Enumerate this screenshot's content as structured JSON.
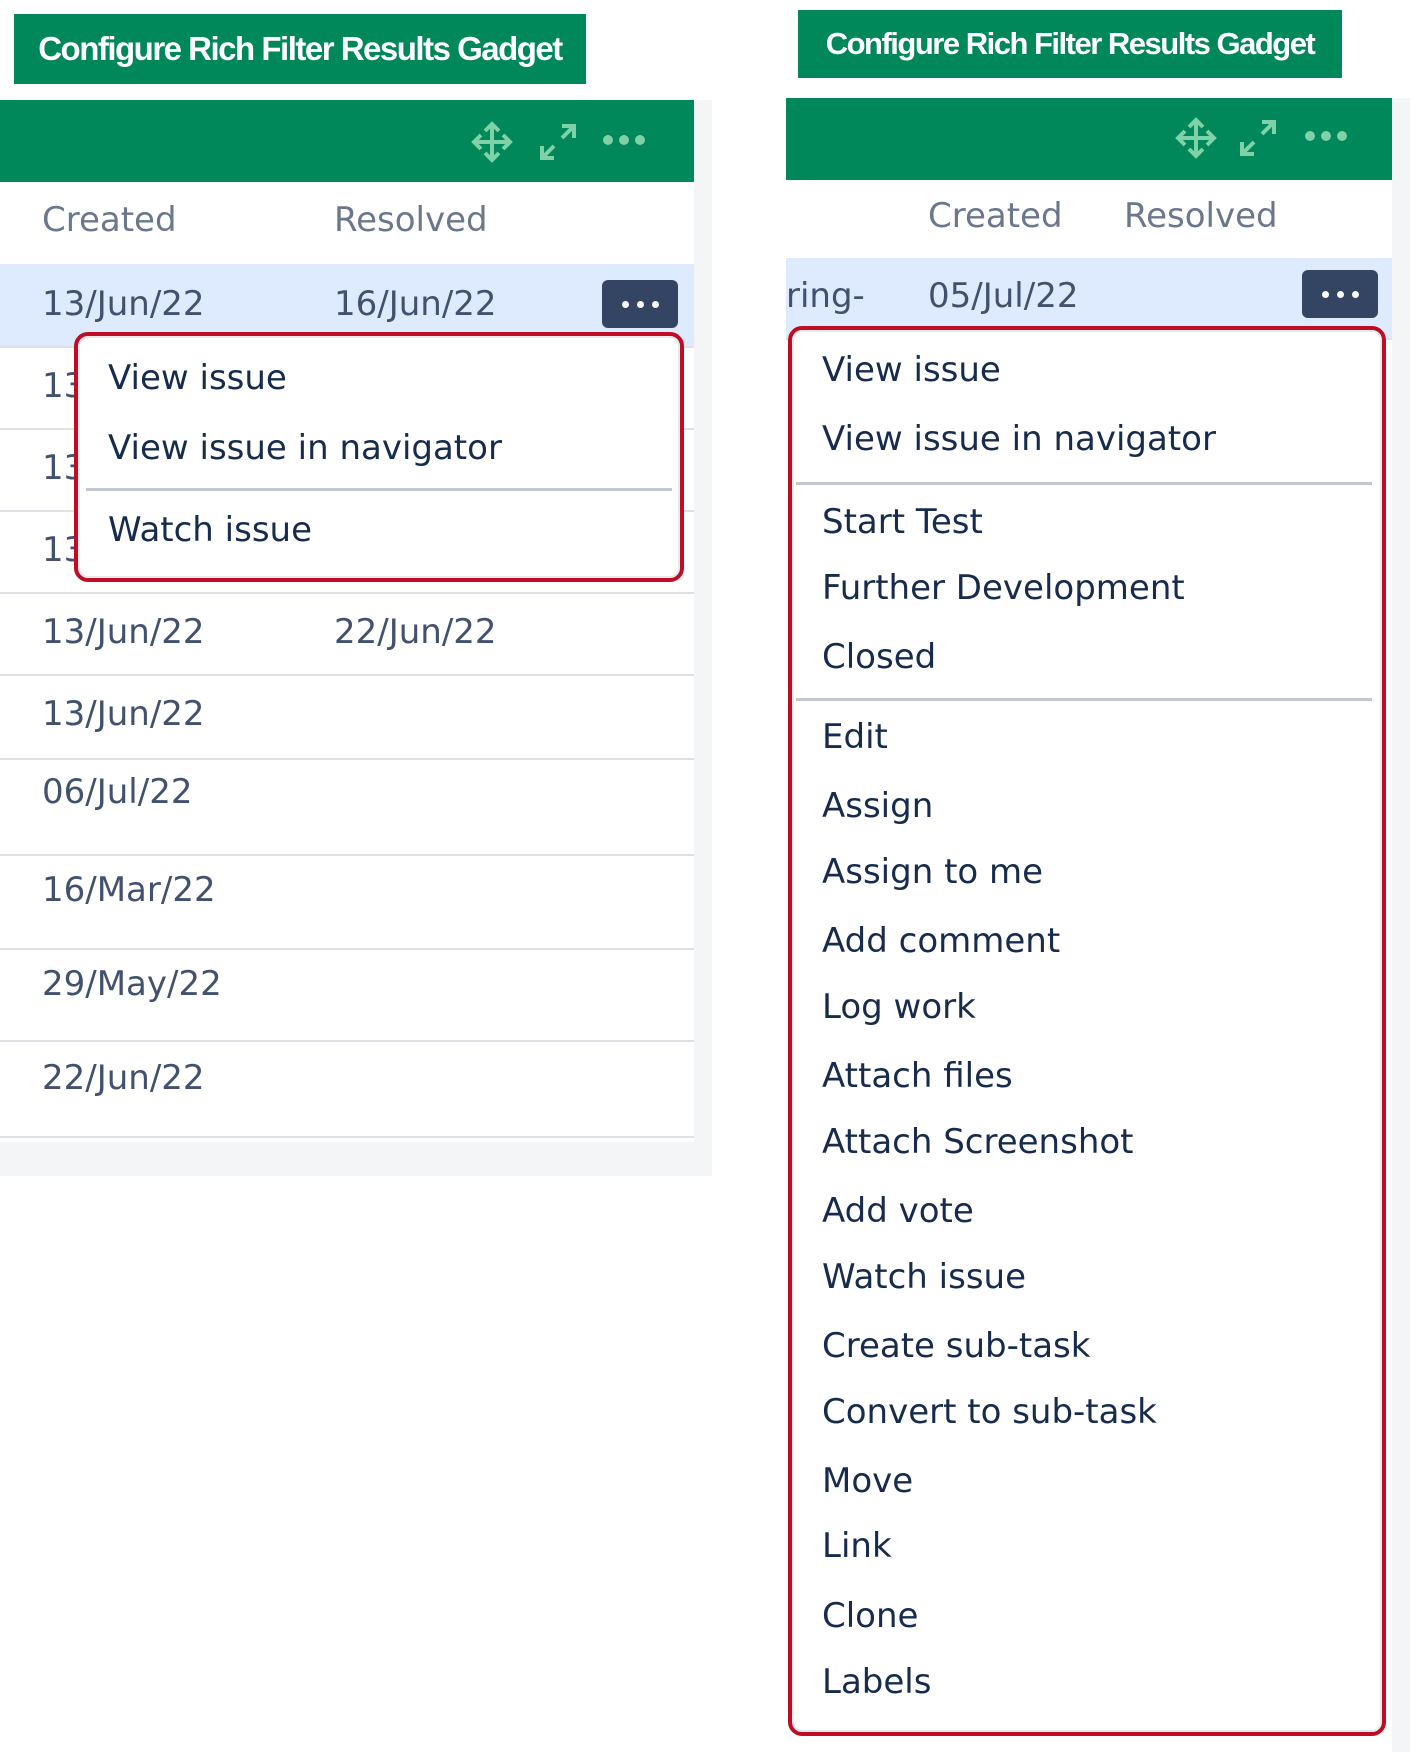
{
  "left": {
    "configure_label": "Configure Rich Filter Results Gadget",
    "columns": [
      "Created",
      "Resolved"
    ],
    "rows": [
      {
        "created": "13/Jun/22",
        "resolved": "16/Jun/22"
      },
      {
        "created": "13",
        "resolved": ""
      },
      {
        "created": "13",
        "resolved": ""
      },
      {
        "created": "13",
        "resolved": ""
      },
      {
        "created": "13/Jun/22",
        "resolved": "22/Jun/22"
      },
      {
        "created": "13/Jun/22",
        "resolved": ""
      },
      {
        "created": "06/Jul/22",
        "resolved": ""
      },
      {
        "created": "16/Mar/22",
        "resolved": ""
      },
      {
        "created": "29/May/22",
        "resolved": ""
      },
      {
        "created": "22/Jun/22",
        "resolved": ""
      }
    ],
    "menu": {
      "items": [
        "View issue",
        "View issue in navigator",
        "Watch issue"
      ]
    }
  },
  "right": {
    "configure_label": "Configure Rich Filter Results Gadget",
    "columns": [
      "Created",
      "Resolved"
    ],
    "first_row": {
      "summary_fragment": "ring-",
      "created": "05/Jul/22"
    },
    "menu": {
      "items": [
        "View issue",
        "View issue in navigator",
        "Start Test",
        "Further Development",
        "Closed",
        "Edit",
        "Assign",
        "Assign to me",
        "Add comment",
        "Log work",
        "Attach files",
        "Attach Screenshot",
        "Add vote",
        "Watch issue",
        "Create sub-task",
        "Convert to sub-task",
        "Move",
        "Link",
        "Clone",
        "Labels"
      ]
    }
  },
  "icons": {
    "move": "move-icon",
    "expand": "expand-icon",
    "more": "more-icon"
  },
  "colors": {
    "brand_green": "#00875a",
    "highlight_red": "#c00d26",
    "dots_button": "#344563",
    "selected_row": "#deebff"
  }
}
